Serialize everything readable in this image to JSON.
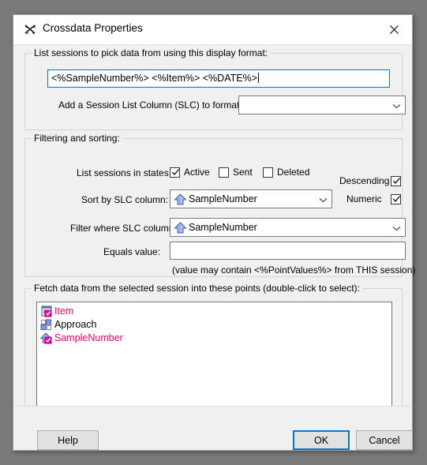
{
  "window": {
    "title": "Crossdata Properties",
    "icon": "crossdata-icon",
    "close_icon": "close-icon"
  },
  "format_group": {
    "legend": "List sessions to pick data from using this display format:",
    "display_format_value": "<%SampleNumber%>  <%Item%>  <%DATE%>",
    "slc_label": "Add a Session List Column (SLC) to format:",
    "slc_value": "",
    "slc_placeholder": ""
  },
  "filter_group": {
    "legend": "Filtering and sorting:",
    "states_label": "List sessions in states:",
    "states": [
      {
        "label": "Active",
        "checked": true
      },
      {
        "label": "Sent",
        "checked": false
      },
      {
        "label": "Deleted",
        "checked": false
      }
    ],
    "descending": {
      "label": "Descending",
      "checked": true
    },
    "numeric": {
      "label": "Numeric",
      "checked": true
    },
    "sort_label": "Sort by SLC column:",
    "sort_value": "SampleNumber",
    "sort_icon": "up-arrow-icon",
    "filter_label": "Filter where SLC column:",
    "filter_value": "SampleNumber",
    "filter_icon": "up-arrow-icon",
    "equals_label": "Equals value:",
    "equals_value": "",
    "hint": "(value may contain <%PointValues%> from THIS session)"
  },
  "fetch_group": {
    "legend": "Fetch data from the selected session into these points (double-click to select):",
    "items": [
      {
        "label": "Item",
        "icon": "list-point-icon",
        "selected": true,
        "color": "#ff0066"
      },
      {
        "label": "Approach",
        "icon": "squares-point-icon",
        "selected": false,
        "color": "#000000"
      },
      {
        "label": "SampleNumber",
        "icon": "up-arrow-point-icon",
        "selected": true,
        "color": "#ff0066"
      }
    ]
  },
  "footer": {
    "help_label": "Help",
    "ok_label": "OK",
    "cancel_label": "Cancel"
  },
  "colors": {
    "accent": "#0078d7",
    "selected_text": "#ff0066",
    "arrow_blue": "#8fa8e8",
    "badge_magenta": "#ee00aa"
  }
}
